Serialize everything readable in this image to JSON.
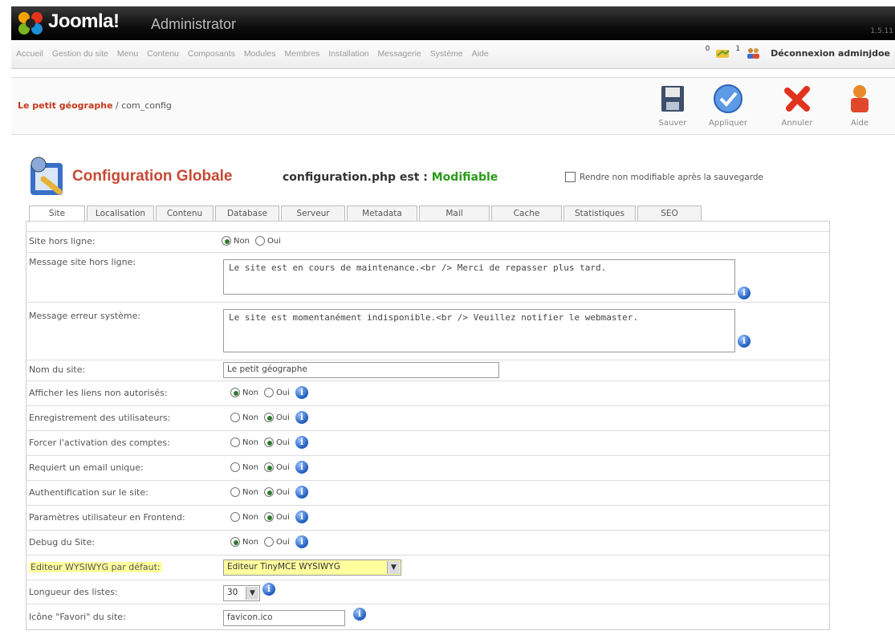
{
  "header": {
    "logo_text": "Joomla!",
    "logo_sub": "Administrator",
    "version": "1.5.11"
  },
  "menu": {
    "items": [
      "Accueil",
      "Gestion du site",
      "Menu",
      "Contenu",
      "Composants",
      "Modules",
      "Membres",
      "Installation",
      "Messagerie",
      "Système",
      "Aide"
    ],
    "messages_count": "0",
    "users_count": "1",
    "logout_label": "Déconnexion adminjdoe"
  },
  "toolbar": {
    "site_name": "Le petit géographe",
    "path": " / com_config",
    "buttons": {
      "save": "Sauver",
      "apply": "Appliquer",
      "cancel": "Annuler",
      "help": "Aide"
    }
  },
  "heading": {
    "title": "Configuration Globale",
    "file_label": "configuration.php est : ",
    "file_status": "Modifiable",
    "lock_label": "Rendre non modifiable après la sauvegarde"
  },
  "tabs": [
    "Site",
    "Localisation",
    "Contenu",
    "Database",
    "Serveur",
    "Metadata",
    "Mail",
    "Cache",
    "Statistiques",
    "SEO"
  ],
  "form": {
    "no": "Non",
    "yes": "Oui",
    "offline": {
      "label": "Site hors ligne:",
      "value": "Non"
    },
    "offline_msg": {
      "label": "Message site hors ligne:",
      "value": "Le site est en cours de maintenance.<br /> Merci de repasser plus tard."
    },
    "error_msg": {
      "label": "Message erreur système:",
      "value": "Le site est momentanément indisponible.<br /> Veuillez notifier le webmaster."
    },
    "site_name": {
      "label": "Nom du site:",
      "value": "Le petit géographe"
    },
    "unauth_links": {
      "label": "Afficher les liens non autorisés:",
      "value": "Non"
    },
    "user_reg": {
      "label": "Enregistrement des utilisateurs:",
      "value": "Oui"
    },
    "activation": {
      "label": "Forcer l'activation des comptes:",
      "value": "Oui"
    },
    "unique_email": {
      "label": "Requiert un email unique:",
      "value": "Oui"
    },
    "site_auth": {
      "label": "Authentification sur le site:",
      "value": "Oui"
    },
    "frontend_params": {
      "label": "Paramètres utilisateur en Frontend:",
      "value": "Oui"
    },
    "debug": {
      "label": "Debug du Site:",
      "value": "Non"
    },
    "editor": {
      "label": "Editeur WYSIWYG par défaut:",
      "value": "Editeur TinyMCE WYSIWYG"
    },
    "list_length": {
      "label": "Longueur des listes:",
      "value": "30"
    },
    "favicon": {
      "label": "Icône \"Favori\" du site:",
      "value": "favicon.ico"
    }
  },
  "colors": {
    "title_red": "#c64934",
    "status_green": "#2b9a1a",
    "highlight": "#ffff9e"
  }
}
